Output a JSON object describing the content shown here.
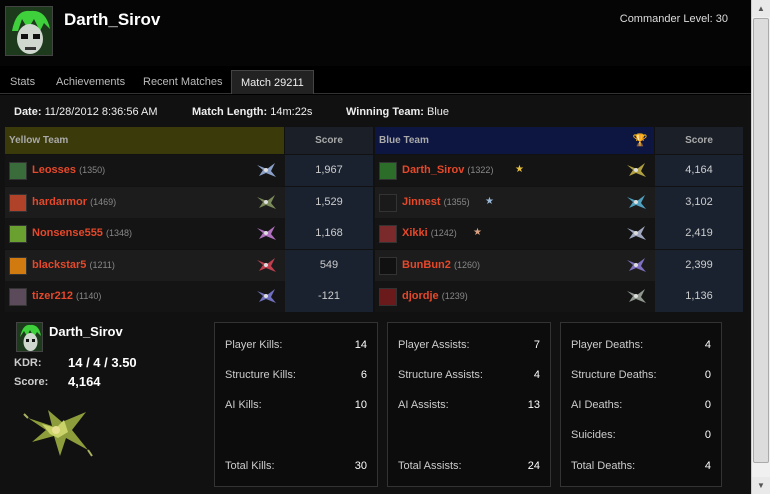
{
  "header": {
    "player_name": "Darth_Sirov",
    "commander_level_label": "Commander Level:",
    "commander_level_value": "30"
  },
  "tabs": [
    {
      "label": "Stats"
    },
    {
      "label": "Achievements"
    },
    {
      "label": "Recent Matches"
    },
    {
      "label": "Match 29211",
      "active": true
    }
  ],
  "match": {
    "date_label": "Date:",
    "date_value": "11/28/2012 8:36:56 AM",
    "length_label": "Match Length:",
    "length_value": "14m:22s",
    "winner_label": "Winning Team:",
    "winner_value": "Blue"
  },
  "yellow_team": {
    "title": "Yellow Team",
    "score_header": "Score",
    "color": "#3a3a0a",
    "players": [
      {
        "name": "Leosses",
        "rating": "(1350)",
        "score": "1,967"
      },
      {
        "name": "hardarmor",
        "rating": "(1469)",
        "score": "1,529"
      },
      {
        "name": "Nonsense555",
        "rating": "(1348)",
        "score": "1,168"
      },
      {
        "name": "blackstar5",
        "rating": "(1211)",
        "score": "549"
      },
      {
        "name": "tizer212",
        "rating": "(1140)",
        "score": "-121"
      }
    ]
  },
  "blue_team": {
    "title": "Blue Team",
    "score_header": "Score",
    "color": "#0d1640",
    "players": [
      {
        "name": "Darth_Sirov",
        "rating": "(1322)",
        "score": "4,164"
      },
      {
        "name": "Jinnest",
        "rating": "(1355)",
        "score": "3,102"
      },
      {
        "name": "Xikki",
        "rating": "(1242)",
        "score": "2,419"
      },
      {
        "name": "BunBun2",
        "rating": "(1260)",
        "score": "2,399"
      },
      {
        "name": "djordje",
        "rating": "(1239)",
        "score": "1,136"
      }
    ]
  },
  "summary": {
    "name": "Darth_Sirov",
    "kdr_label": "KDR:",
    "kdr_value": "14 / 4 / 3.50",
    "score_label": "Score:",
    "score_value": "4,164"
  },
  "kills": {
    "player_label": "Player Kills:",
    "player_value": "14",
    "structure_label": "Structure Kills:",
    "structure_value": "6",
    "ai_label": "AI Kills:",
    "ai_value": "10",
    "total_label": "Total Kills:",
    "total_value": "30"
  },
  "assists": {
    "player_label": "Player Assists:",
    "player_value": "7",
    "structure_label": "Structure Assists:",
    "structure_value": "4",
    "ai_label": "AI Assists:",
    "ai_value": "13",
    "total_label": "Total Assists:",
    "total_value": "24"
  },
  "deaths": {
    "player_label": "Player Deaths:",
    "player_value": "4",
    "structure_label": "Structure Deaths:",
    "structure_value": "0",
    "ai_label": "AI Deaths:",
    "ai_value": "0",
    "suicides_label": "Suicides:",
    "suicides_value": "0",
    "total_label": "Total Deaths:",
    "total_value": "4"
  },
  "colors": {
    "player_name": "#e5482a",
    "row_dark": "#141414",
    "row_light": "#1c1c1c",
    "score_col": "#1a2230"
  }
}
